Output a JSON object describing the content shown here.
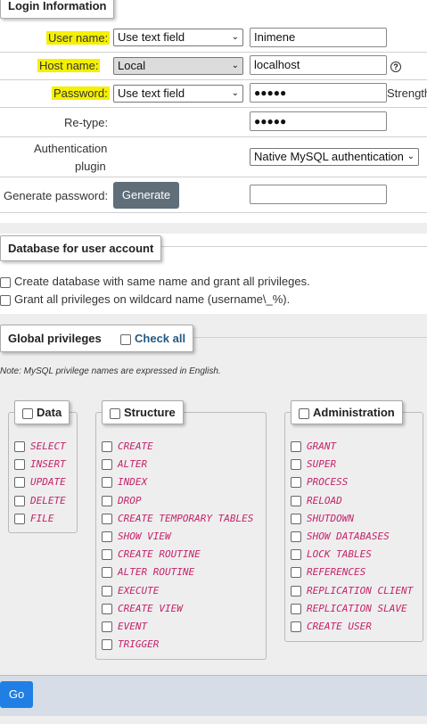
{
  "login": {
    "legend": "Login Information",
    "username_label": "User name:",
    "username_select": "Use text field",
    "username_value": "Inimene",
    "hostname_label": "Host name:",
    "hostname_select": "Local",
    "hostname_value": "localhost",
    "password_label": "Password:",
    "password_select": "Use text field",
    "password_value": "●●●●●",
    "strength_label": "Strength:",
    "retype_label": "Re-type:",
    "retype_value": "●●●●●",
    "auth_label_1": "Authentication",
    "auth_label_2": "plugin",
    "auth_select": "Native MySQL authentication",
    "genpass_label": "Generate password:",
    "generate_button": "Generate"
  },
  "database": {
    "legend": "Database for user account",
    "option_create": "Create database with same name and grant all privileges.",
    "option_wildcard": "Grant all privileges on wildcard name (username\\_%)."
  },
  "global": {
    "legend": "Global privileges",
    "check_all": "Check all",
    "note": "Note: MySQL privilege names are expressed in English."
  },
  "groups": {
    "data": {
      "title": "Data",
      "items": [
        "SELECT",
        "INSERT",
        "UPDATE",
        "DELETE",
        "FILE"
      ]
    },
    "structure": {
      "title": "Structure",
      "items": [
        "CREATE",
        "ALTER",
        "INDEX",
        "DROP",
        "CREATE TEMPORARY TABLES",
        "SHOW VIEW",
        "CREATE ROUTINE",
        "ALTER ROUTINE",
        "EXECUTE",
        "CREATE VIEW",
        "EVENT",
        "TRIGGER"
      ]
    },
    "administration": {
      "title": "Administration",
      "items": [
        "GRANT",
        "SUPER",
        "PROCESS",
        "RELOAD",
        "SHUTDOWN",
        "SHOW DATABASES",
        "LOCK TABLES",
        "REFERENCES",
        "REPLICATION CLIENT",
        "REPLICATION SLAVE",
        "CREATE USER"
      ]
    }
  },
  "footer": {
    "go_button": "Go"
  },
  "colors": {
    "highlight": "#f4f000",
    "privilege_text": "#c4246b",
    "go_button": "#1f7fe5",
    "generate_button": "#5f6e79"
  }
}
